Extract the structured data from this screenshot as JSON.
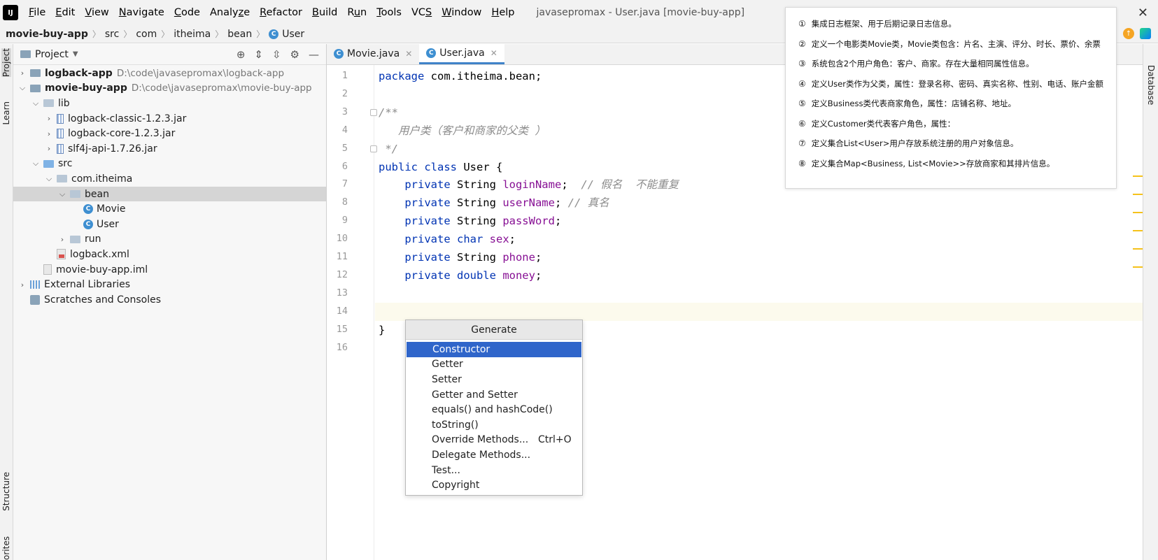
{
  "window": {
    "logo_text": "IJ",
    "title": "javasepromax - User.java [movie-buy-app]",
    "close_glyph": "✕"
  },
  "menu": [
    {
      "pre": "",
      "key": "F",
      "post": "ile"
    },
    {
      "pre": "",
      "key": "E",
      "post": "dit"
    },
    {
      "pre": "",
      "key": "V",
      "post": "iew"
    },
    {
      "pre": "",
      "key": "N",
      "post": "avigate"
    },
    {
      "pre": "",
      "key": "C",
      "post": "ode"
    },
    {
      "pre": "Analy",
      "key": "z",
      "post": "e"
    },
    {
      "pre": "",
      "key": "R",
      "post": "efactor"
    },
    {
      "pre": "",
      "key": "B",
      "post": "uild"
    },
    {
      "pre": "R",
      "key": "u",
      "post": "n"
    },
    {
      "pre": "",
      "key": "T",
      "post": "ools"
    },
    {
      "pre": "VC",
      "key": "S",
      "post": ""
    },
    {
      "pre": "",
      "key": "W",
      "post": "indow"
    },
    {
      "pre": "",
      "key": "H",
      "post": "elp"
    }
  ],
  "breadcrumb": [
    "movie-buy-app",
    "src",
    "com",
    "itheima",
    "bean",
    "User"
  ],
  "left_tabs": {
    "project": "Project",
    "learn": "Learn",
    "structure": "Structure",
    "favorites": "Favorites"
  },
  "right_tabs": {
    "database": "Database"
  },
  "project_panel": {
    "title": "Project",
    "tree": [
      {
        "indent": 0,
        "chev": "›",
        "icon": "module",
        "label": "logback-app",
        "bold": true,
        "path": "D:\\code\\javasepromax\\logback-app"
      },
      {
        "indent": 0,
        "chev": "⌄",
        "icon": "module",
        "label": "movie-buy-app",
        "bold": true,
        "path": "D:\\code\\javasepromax\\movie-buy-app"
      },
      {
        "indent": 1,
        "chev": "⌄",
        "icon": "folder",
        "label": "lib"
      },
      {
        "indent": 2,
        "chev": "›",
        "icon": "jar",
        "label": "logback-classic-1.2.3.jar"
      },
      {
        "indent": 2,
        "chev": "›",
        "icon": "jar",
        "label": "logback-core-1.2.3.jar"
      },
      {
        "indent": 2,
        "chev": "›",
        "icon": "jar",
        "label": "slf4j-api-1.7.26.jar"
      },
      {
        "indent": 1,
        "chev": "⌄",
        "icon": "src",
        "label": "src"
      },
      {
        "indent": 2,
        "chev": "⌄",
        "icon": "package",
        "label": "com.itheima"
      },
      {
        "indent": 3,
        "chev": "⌄",
        "icon": "package",
        "label": "bean",
        "selected": true
      },
      {
        "indent": 4,
        "chev": "",
        "icon": "class",
        "label": "Movie"
      },
      {
        "indent": 4,
        "chev": "",
        "icon": "class",
        "label": "User"
      },
      {
        "indent": 3,
        "chev": "›",
        "icon": "package",
        "label": "run"
      },
      {
        "indent": 2,
        "chev": "",
        "icon": "xml",
        "label": "logback.xml"
      },
      {
        "indent": 1,
        "chev": "",
        "icon": "iml",
        "label": "movie-buy-app.iml"
      },
      {
        "indent": 0,
        "chev": "›",
        "icon": "lib",
        "label": "External Libraries"
      },
      {
        "indent": 0,
        "chev": "",
        "icon": "scratch",
        "label": "Scratches and Consoles"
      }
    ]
  },
  "editor": {
    "tabs": [
      {
        "label": "Movie.java",
        "active": false
      },
      {
        "label": "User.java",
        "active": true
      }
    ],
    "current_line": 14,
    "lines": [
      [
        {
          "t": "package",
          "c": "kw"
        },
        {
          "t": " com.itheima.bean;",
          "c": "type"
        }
      ],
      [],
      [
        {
          "t": "/**",
          "c": "cm"
        }
      ],
      [
        {
          "t": "   用户类（客户和商家的父类 ）",
          "c": "cm"
        }
      ],
      [
        {
          "t": " */",
          "c": "cm"
        }
      ],
      [
        {
          "t": "public class ",
          "c": "kw"
        },
        {
          "t": "User",
          "c": "cls"
        },
        {
          "t": " {",
          "c": "type"
        }
      ],
      [
        {
          "t": "    private ",
          "c": "kw"
        },
        {
          "t": "String ",
          "c": "type"
        },
        {
          "t": "loginName",
          "c": "field"
        },
        {
          "t": ";  ",
          "c": "type"
        },
        {
          "t": "// 假名  不能重复",
          "c": "cm"
        }
      ],
      [
        {
          "t": "    private ",
          "c": "kw"
        },
        {
          "t": "String ",
          "c": "type"
        },
        {
          "t": "userName",
          "c": "field"
        },
        {
          "t": "; ",
          "c": "type"
        },
        {
          "t": "// 真名",
          "c": "cm"
        }
      ],
      [
        {
          "t": "    private ",
          "c": "kw"
        },
        {
          "t": "String ",
          "c": "type"
        },
        {
          "t": "passWord",
          "c": "field"
        },
        {
          "t": ";",
          "c": "type"
        }
      ],
      [
        {
          "t": "    private ",
          "c": "kw"
        },
        {
          "t": "char ",
          "c": "kw"
        },
        {
          "t": "sex",
          "c": "field"
        },
        {
          "t": ";",
          "c": "type"
        }
      ],
      [
        {
          "t": "    private ",
          "c": "kw"
        },
        {
          "t": "String ",
          "c": "type"
        },
        {
          "t": "phone",
          "c": "field"
        },
        {
          "t": ";",
          "c": "type"
        }
      ],
      [
        {
          "t": "    private ",
          "c": "kw"
        },
        {
          "t": "double ",
          "c": "kw"
        },
        {
          "t": "money",
          "c": "field"
        },
        {
          "t": ";",
          "c": "type"
        }
      ],
      [],
      [],
      [
        {
          "t": "}",
          "c": "type"
        }
      ],
      []
    ]
  },
  "generate_popup": {
    "title": "Generate",
    "items": [
      {
        "label": "Constructor",
        "selected": true
      },
      {
        "label": "Getter"
      },
      {
        "label": "Setter"
      },
      {
        "label": "Getter and Setter"
      },
      {
        "label": "equals() and hashCode()"
      },
      {
        "label": "toString()"
      },
      {
        "label": "Override Methods...",
        "shortcut": "Ctrl+O"
      },
      {
        "label": "Delegate Methods..."
      },
      {
        "label": "Test..."
      },
      {
        "label": "Copyright"
      }
    ]
  },
  "notes": [
    {
      "num": "①",
      "text": "集成日志框架、用于后期记录日志信息。"
    },
    {
      "num": "②",
      "text": "定义一个电影类Movie类，Movie类包含：片名、主演、评分、时长、票价、余票"
    },
    {
      "num": "③",
      "text": "系统包含2个用户角色：客户、商家。存在大量相同属性信息。"
    },
    {
      "num": "④",
      "text": "定义User类作为父类，属性：登录名称、密码、真实名称、性别、电话、账户金额"
    },
    {
      "num": "⑤",
      "text": "定义Business类代表商家角色，属性：店铺名称、地址。"
    },
    {
      "num": "⑥",
      "text": "定义Customer类代表客户角色，属性："
    },
    {
      "num": "⑦",
      "text": "定义集合List<User>用户存放系统注册的用户对象信息。"
    },
    {
      "num": "⑧",
      "text": "定义集合Map<Business, List<Movie>>存放商家和其排片信息。"
    }
  ]
}
